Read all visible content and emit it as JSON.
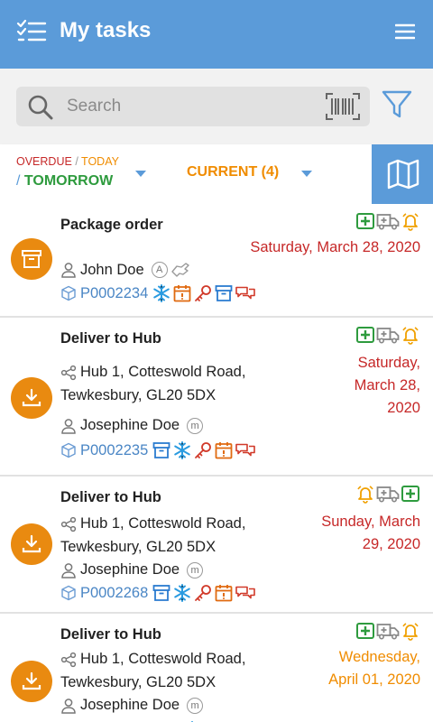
{
  "header": {
    "title": "My tasks",
    "list_icon": "checklist-icon",
    "menu_icon": "hamburger-menu-icon"
  },
  "search": {
    "placeholder": "Search",
    "icon": "search-icon",
    "barcode_icon": "barcode-scan-icon",
    "filter_icon": "filter-funnel-icon"
  },
  "filters": {
    "overdue": "OVERDUE",
    "separator": "/",
    "today": "TODAY",
    "tomorrow_prefix": "/",
    "tomorrow": "TOMORROW",
    "current": "CURRENT (4)",
    "map_icon": "map-icon"
  },
  "colors": {
    "primary": "#5b9bd9",
    "accent_orange": "#e98a10",
    "overdue_red": "#c62828",
    "today_orange": "#f08c00",
    "tomorrow_green": "#2e9b3e",
    "link_blue": "#4a86c5"
  },
  "tasks": [
    {
      "title": "Package order",
      "type_icon": "archive-box-icon",
      "date": "Saturday, March 28, 2020",
      "person": "John Doe",
      "person_badge": "A",
      "id": "P0002234",
      "status_icons": [
        "medical-plus-icon",
        "ambulance-truck-icon",
        "alarm-bell-icon"
      ]
    },
    {
      "title": "Deliver to Hub",
      "type_icon": "download-tray-icon",
      "address_line1": "Hub 1, Cotteswold Road,",
      "address_line2": "Tewkesbury, GL20 5DX",
      "date_line1": "Saturday,",
      "date_line2": "March 28,",
      "date_line3": "2020",
      "person": "Josephine Doe",
      "person_badge": "m",
      "id": "P0002235",
      "status_icons": [
        "medical-plus-icon",
        "ambulance-truck-icon",
        "alarm-bell-icon"
      ]
    },
    {
      "title": "Deliver to Hub",
      "type_icon": "download-tray-icon",
      "address_line1": "Hub 1, Cotteswold Road,",
      "address_line2": "Tewkesbury, GL20 5DX",
      "date_line1": "Sunday, March",
      "date_line2": "29, 2020",
      "person": "Josephine Doe",
      "person_badge": "m",
      "id": "P0002268",
      "status_icons": [
        "alarm-bell-icon",
        "ambulance-truck-icon",
        "medical-plus-icon"
      ]
    },
    {
      "title": "Deliver to Hub",
      "type_icon": "download-tray-icon",
      "address_line1": "Hub 1, Cotteswold Road,",
      "address_line2": "Tewkesbury, GL20 5DX",
      "date_line1": "Wednesday,",
      "date_line2": "April 01, 2020",
      "person": "Josephine Doe",
      "person_badge": "m",
      "status_icons": [
        "medical-plus-icon",
        "ambulance-truck-icon",
        "alarm-bell-icon"
      ]
    }
  ]
}
